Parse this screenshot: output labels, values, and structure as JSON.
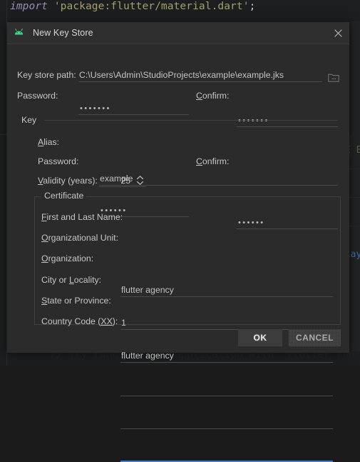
{
  "background": {
    "code_top": {
      "keyword": "import",
      "string": "'package:flutter/material.dart'",
      "semicolon": ";"
    },
    "code_dim": "// Try running your application with 'flutter run'",
    "fragment_right_upper": "E E",
    "fragment_right_lower": "'lay"
  },
  "dialog": {
    "title": "New Key Store",
    "icon": "android-icon",
    "close_icon": "close-icon",
    "keystore": {
      "path_label": "Key store path:",
      "path_value": "C:\\Users\\Admin\\StudioProjects\\example\\example.jks",
      "browse_icon": "folder-browse-icon",
      "password_label": "Password:",
      "password_value": "•••••••",
      "confirm_label": "Confirm:",
      "confirm_value": "•••••••"
    },
    "key": {
      "group_label": "Key",
      "alias_label": "Alias:",
      "alias_value": "example",
      "password_label": "Password:",
      "password_value": "••••••",
      "confirm_label": "Confirm:",
      "confirm_value": "••••••",
      "validity_label": "Validity (years):",
      "validity_value": "25",
      "spinner_icon": "spinner-updown-icon"
    },
    "certificate": {
      "legend": "Certificate",
      "fields": [
        {
          "label": "First and Last Name:",
          "value": "flutter agency",
          "focused": false
        },
        {
          "label": "Organizational Unit:",
          "value": "1",
          "focused": false
        },
        {
          "label": "Organization:",
          "value": "flutter agency",
          "focused": false
        },
        {
          "label": "City or Locality:",
          "value": "",
          "focused": false
        },
        {
          "label": "State or Province:",
          "value": "",
          "focused": false
        },
        {
          "label": "Country Code (XX):",
          "value": "",
          "focused": true
        }
      ]
    },
    "buttons": {
      "ok": "OK",
      "cancel": "CANCEL"
    },
    "colors": {
      "accent": "#3e7dd6",
      "android_green": "#3ddc84",
      "dialog_bg": "#2b2b2b"
    }
  }
}
